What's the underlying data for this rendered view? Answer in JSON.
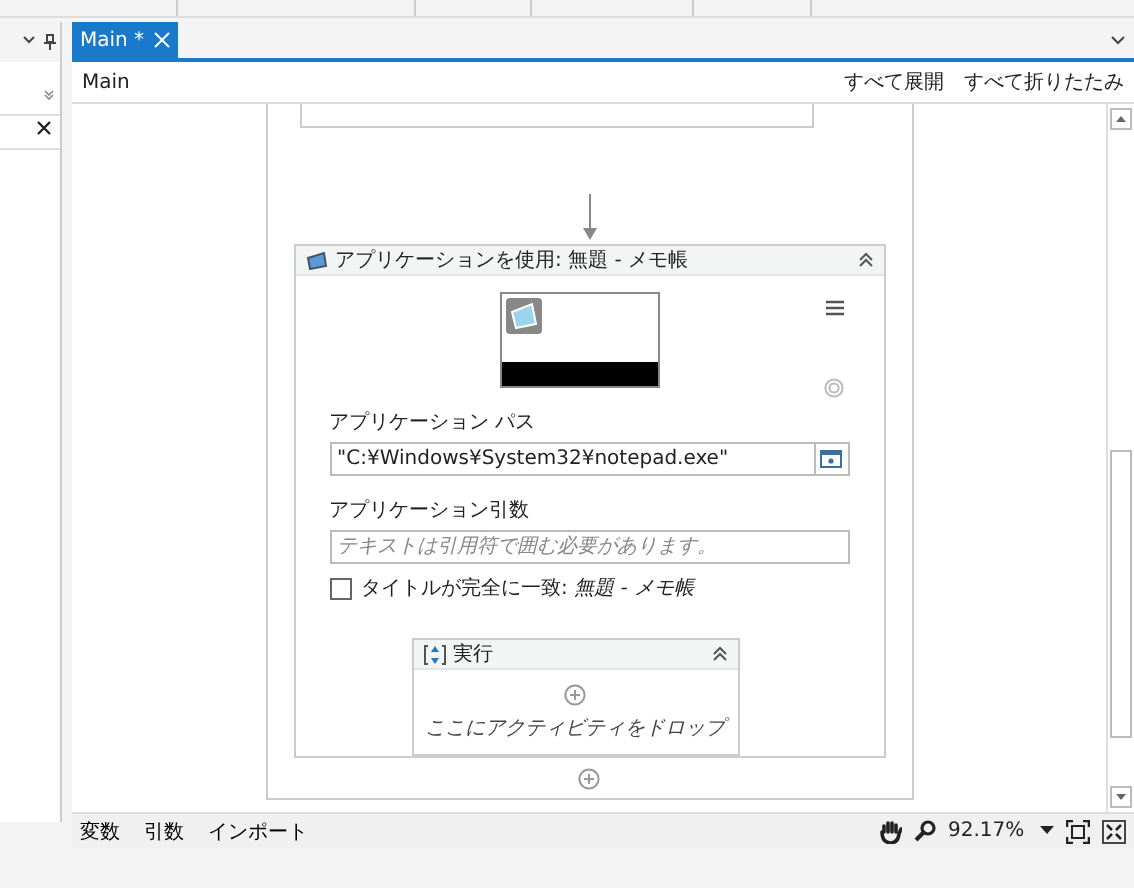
{
  "tabs": [
    {
      "label": "Main *",
      "selected": true
    }
  ],
  "breadcrumb": "Main",
  "header_actions": [
    "すべて展開",
    "すべて折りたたみ"
  ],
  "activity": {
    "title": "アプリケーションを使用: 無題 - メモ帳",
    "expanded": true,
    "path_label": "アプリケーション パス",
    "path_value": "\"C:¥Windows¥System32¥notepad.exe\"",
    "args_label": "アプリケーション引数",
    "args_placeholder": "テキストは引用符で囲む必要があります。",
    "match": {
      "label": "タイトルが完全に一致: *無題 - メモ帳*",
      "checked": false
    },
    "do": {
      "title": "実行",
      "expanded": true,
      "drop_hint": "ここにアクティビティをドロップ"
    }
  },
  "status_bar": {
    "tabs": [
      "変数",
      "引数",
      "インポート"
    ],
    "zoom": "92.17%"
  }
}
